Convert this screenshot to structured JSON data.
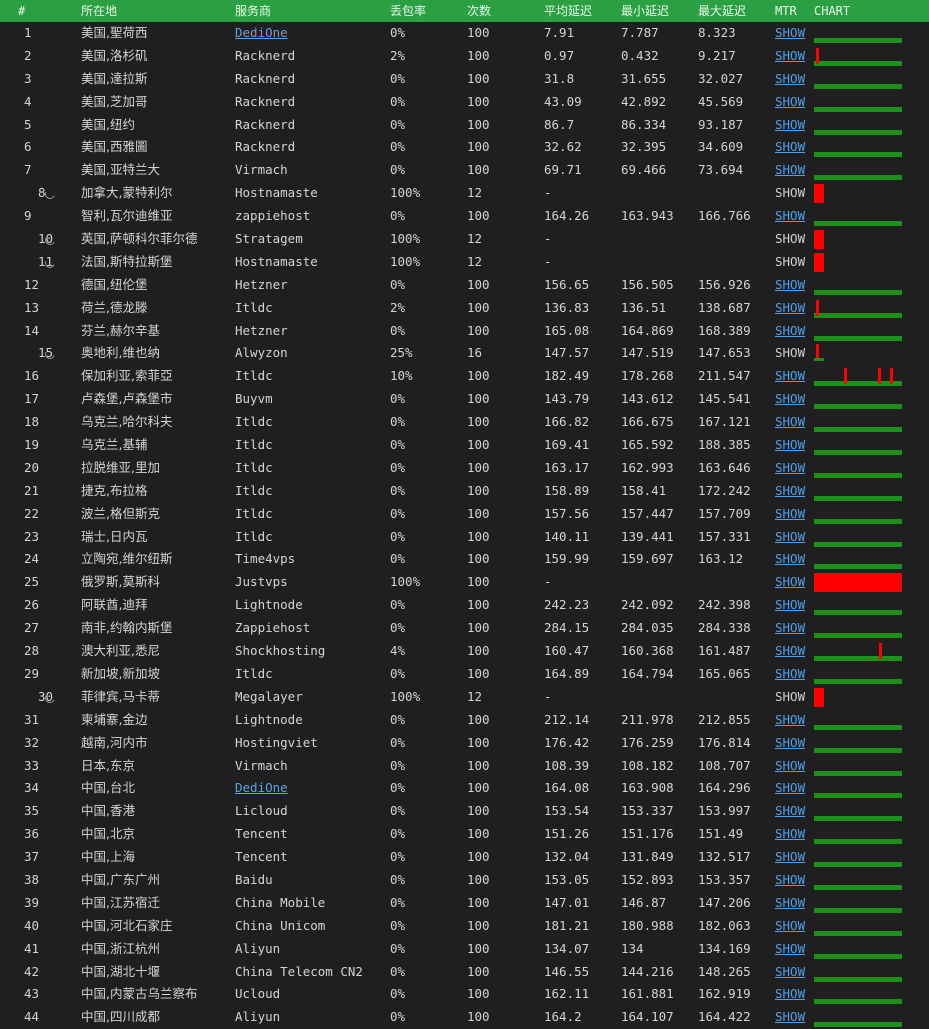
{
  "header": {
    "num": "#",
    "loc": "所在地",
    "prov": "服务商",
    "loss": "丢包率",
    "cnt": "次数",
    "avg": "平均延迟",
    "min": "最小延迟",
    "max": "最大延迟",
    "mtr": "MTR",
    "chart": "CHART"
  },
  "colors": {
    "header_bg": "#2aa042",
    "bar_green": "#1c8f1c",
    "bar_red": "#ff0000",
    "link": "#4d9fec"
  },
  "rows": [
    {
      "num": "1",
      "loc": "美国,聖荷西",
      "prov": "DediOne",
      "provLink": true,
      "loss": "0%",
      "cnt": "100",
      "avg": "7.91",
      "min": "7.787",
      "max": "8.323",
      "mtr": "SHOW",
      "mtrLink": true,
      "pending": false,
      "spark": "green",
      "spikes": []
    },
    {
      "num": "2",
      "loc": "美国,洛杉矶",
      "prov": "Racknerd",
      "provLink": false,
      "loss": "2%",
      "cnt": "100",
      "avg": "0.97",
      "min": "0.432",
      "max": "9.217",
      "mtr": "SHOW",
      "mtrLink": true,
      "pending": false,
      "spark": "green",
      "spikes": [
        0.02
      ]
    },
    {
      "num": "3",
      "loc": "美国,達拉斯",
      "prov": "Racknerd",
      "provLink": false,
      "loss": "0%",
      "cnt": "100",
      "avg": "31.8",
      "min": "31.655",
      "max": "32.027",
      "mtr": "SHOW",
      "mtrLink": true,
      "pending": false,
      "spark": "green",
      "spikes": []
    },
    {
      "num": "4",
      "loc": "美国,芝加哥",
      "prov": "Racknerd",
      "provLink": false,
      "loss": "0%",
      "cnt": "100",
      "avg": "43.09",
      "min": "42.892",
      "max": "45.569",
      "mtr": "SHOW",
      "mtrLink": true,
      "pending": false,
      "spark": "green",
      "spikes": []
    },
    {
      "num": "5",
      "loc": "美国,纽约",
      "prov": "Racknerd",
      "provLink": false,
      "loss": "0%",
      "cnt": "100",
      "avg": "86.7",
      "min": "86.334",
      "max": "93.187",
      "mtr": "SHOW",
      "mtrLink": true,
      "pending": false,
      "spark": "green",
      "spikes": []
    },
    {
      "num": "6",
      "loc": "美国,西雅圖",
      "prov": "Racknerd",
      "provLink": false,
      "loss": "0%",
      "cnt": "100",
      "avg": "32.62",
      "min": "32.395",
      "max": "34.609",
      "mtr": "SHOW",
      "mtrLink": true,
      "pending": false,
      "spark": "green",
      "spikes": []
    },
    {
      "num": "7",
      "loc": "美国,亚特兰大",
      "prov": "Virmach",
      "provLink": false,
      "loss": "0%",
      "cnt": "100",
      "avg": "69.71",
      "min": "69.466",
      "max": "73.694",
      "mtr": "SHOW",
      "mtrLink": true,
      "pending": false,
      "spark": "green",
      "spikes": []
    },
    {
      "num": "8",
      "loc": "加拿大,蒙特利尔",
      "prov": "Hostnamaste",
      "provLink": false,
      "loss": "100%",
      "cnt": "12",
      "avg": "-",
      "min": "",
      "max": "",
      "mtr": "SHOW",
      "mtrLink": false,
      "pending": true,
      "spark": "redshort",
      "spikes": []
    },
    {
      "num": "9",
      "loc": "智利,瓦尔迪维亚",
      "prov": "zappiehost",
      "provLink": false,
      "loss": "0%",
      "cnt": "100",
      "avg": "164.26",
      "min": "163.943",
      "max": "166.766",
      "mtr": "SHOW",
      "mtrLink": true,
      "pending": false,
      "spark": "green",
      "spikes": []
    },
    {
      "num": "10",
      "loc": "英国,萨顿科尔菲尔德",
      "prov": "Stratagem",
      "provLink": false,
      "loss": "100%",
      "cnt": "12",
      "avg": "-",
      "min": "",
      "max": "",
      "mtr": "SHOW",
      "mtrLink": false,
      "pending": true,
      "spark": "redshort",
      "spikes": []
    },
    {
      "num": "11",
      "loc": "法国,斯特拉斯堡",
      "prov": "Hostnamaste",
      "provLink": false,
      "loss": "100%",
      "cnt": "12",
      "avg": "-",
      "min": "",
      "max": "",
      "mtr": "SHOW",
      "mtrLink": false,
      "pending": true,
      "spark": "redshort",
      "spikes": []
    },
    {
      "num": "12",
      "loc": "德国,纽伦堡",
      "prov": "Hetzner",
      "provLink": false,
      "loss": "0%",
      "cnt": "100",
      "avg": "156.65",
      "min": "156.505",
      "max": "156.926",
      "mtr": "SHOW",
      "mtrLink": true,
      "pending": false,
      "spark": "green",
      "spikes": []
    },
    {
      "num": "13",
      "loc": "荷兰,德龙滕",
      "prov": "Itldc",
      "provLink": false,
      "loss": "2%",
      "cnt": "100",
      "avg": "136.83",
      "min": "136.51",
      "max": "138.687",
      "mtr": "SHOW",
      "mtrLink": true,
      "pending": false,
      "spark": "green",
      "spikes": [
        0.02
      ]
    },
    {
      "num": "14",
      "loc": "芬兰,赫尔辛基",
      "prov": "Hetzner",
      "provLink": false,
      "loss": "0%",
      "cnt": "100",
      "avg": "165.08",
      "min": "164.869",
      "max": "168.389",
      "mtr": "SHOW",
      "mtrLink": true,
      "pending": false,
      "spark": "green",
      "spikes": []
    },
    {
      "num": "15",
      "loc": "奥地利,维也纳",
      "prov": "Alwyzon",
      "provLink": false,
      "loss": "25%",
      "cnt": "16",
      "avg": "147.57",
      "min": "147.519",
      "max": "147.653",
      "mtr": "SHOW",
      "mtrLink": false,
      "pending": true,
      "spark": "tiny",
      "spikes": []
    },
    {
      "num": "16",
      "loc": "保加利亚,索菲亞",
      "prov": "Itldc",
      "provLink": false,
      "loss": "10%",
      "cnt": "100",
      "avg": "182.49",
      "min": "178.268",
      "max": "211.547",
      "mtr": "SHOW",
      "mtrLink": true,
      "pending": false,
      "spark": "green",
      "spikes": [
        0.34,
        0.73,
        0.86
      ]
    },
    {
      "num": "17",
      "loc": "卢森堡,卢森堡市",
      "prov": "Buyvm",
      "provLink": false,
      "loss": "0%",
      "cnt": "100",
      "avg": "143.79",
      "min": "143.612",
      "max": "145.541",
      "mtr": "SHOW",
      "mtrLink": true,
      "pending": false,
      "spark": "green",
      "spikes": []
    },
    {
      "num": "18",
      "loc": "乌克兰,哈尔科夫",
      "prov": "Itldc",
      "provLink": false,
      "loss": "0%",
      "cnt": "100",
      "avg": "166.82",
      "min": "166.675",
      "max": "167.121",
      "mtr": "SHOW",
      "mtrLink": true,
      "pending": false,
      "spark": "green",
      "spikes": []
    },
    {
      "num": "19",
      "loc": "乌克兰,基辅",
      "prov": "Itldc",
      "provLink": false,
      "loss": "0%",
      "cnt": "100",
      "avg": "169.41",
      "min": "165.592",
      "max": "188.385",
      "mtr": "SHOW",
      "mtrLink": true,
      "pending": false,
      "spark": "green",
      "spikes": []
    },
    {
      "num": "20",
      "loc": "拉脱维亚,里加",
      "prov": "Itldc",
      "provLink": false,
      "loss": "0%",
      "cnt": "100",
      "avg": "163.17",
      "min": "162.993",
      "max": "163.646",
      "mtr": "SHOW",
      "mtrLink": true,
      "pending": false,
      "spark": "green",
      "spikes": []
    },
    {
      "num": "21",
      "loc": "捷克,布拉格",
      "prov": "Itldc",
      "provLink": false,
      "loss": "0%",
      "cnt": "100",
      "avg": "158.89",
      "min": "158.41",
      "max": "172.242",
      "mtr": "SHOW",
      "mtrLink": true,
      "pending": false,
      "spark": "green",
      "spikes": []
    },
    {
      "num": "22",
      "loc": "波兰,格但斯克",
      "prov": "Itldc",
      "provLink": false,
      "loss": "0%",
      "cnt": "100",
      "avg": "157.56",
      "min": "157.447",
      "max": "157.709",
      "mtr": "SHOW",
      "mtrLink": true,
      "pending": false,
      "spark": "green",
      "spikes": []
    },
    {
      "num": "23",
      "loc": "瑞士,日内瓦",
      "prov": "Itldc",
      "provLink": false,
      "loss": "0%",
      "cnt": "100",
      "avg": "140.11",
      "min": "139.441",
      "max": "157.331",
      "mtr": "SHOW",
      "mtrLink": true,
      "pending": false,
      "spark": "green",
      "spikes": []
    },
    {
      "num": "24",
      "loc": "立陶宛,维尔纽斯",
      "prov": "Time4vps",
      "provLink": false,
      "loss": "0%",
      "cnt": "100",
      "avg": "159.99",
      "min": "159.697",
      "max": "163.12",
      "mtr": "SHOW",
      "mtrLink": true,
      "pending": false,
      "spark": "green",
      "spikes": []
    },
    {
      "num": "25",
      "loc": "俄罗斯,莫斯科",
      "prov": "Justvps",
      "provLink": false,
      "loss": "100%",
      "cnt": "100",
      "avg": "-",
      "min": "",
      "max": "",
      "mtr": "SHOW",
      "mtrLink": true,
      "pending": false,
      "spark": "redfull",
      "spikes": []
    },
    {
      "num": "26",
      "loc": "阿联酋,迪拜",
      "prov": "Lightnode",
      "provLink": false,
      "loss": "0%",
      "cnt": "100",
      "avg": "242.23",
      "min": "242.092",
      "max": "242.398",
      "mtr": "SHOW",
      "mtrLink": true,
      "pending": false,
      "spark": "green",
      "spikes": []
    },
    {
      "num": "27",
      "loc": "南非,约翰内斯堡",
      "prov": "Zappiehost",
      "provLink": false,
      "loss": "0%",
      "cnt": "100",
      "avg": "284.15",
      "min": "284.035",
      "max": "284.338",
      "mtr": "SHOW",
      "mtrLink": true,
      "pending": false,
      "spark": "green",
      "spikes": []
    },
    {
      "num": "28",
      "loc": "澳大利亚,悉尼",
      "prov": "Shockhosting",
      "provLink": false,
      "loss": "4%",
      "cnt": "100",
      "avg": "160.47",
      "min": "160.368",
      "max": "161.487",
      "mtr": "SHOW",
      "mtrLink": true,
      "pending": false,
      "spark": "green",
      "spikes": [
        0.74
      ]
    },
    {
      "num": "29",
      "loc": "新加坡,新加坡",
      "prov": "Itldc",
      "provLink": false,
      "loss": "0%",
      "cnt": "100",
      "avg": "164.89",
      "min": "164.794",
      "max": "165.065",
      "mtr": "SHOW",
      "mtrLink": true,
      "pending": false,
      "spark": "green",
      "spikes": []
    },
    {
      "num": "30",
      "loc": "菲律宾,马卡蒂",
      "prov": "Megalayer",
      "provLink": false,
      "loss": "100%",
      "cnt": "12",
      "avg": "-",
      "min": "",
      "max": "",
      "mtr": "SHOW",
      "mtrLink": false,
      "pending": true,
      "spark": "redshort",
      "spikes": []
    },
    {
      "num": "31",
      "loc": "柬埔寨,金边",
      "prov": "Lightnode",
      "provLink": false,
      "loss": "0%",
      "cnt": "100",
      "avg": "212.14",
      "min": "211.978",
      "max": "212.855",
      "mtr": "SHOW",
      "mtrLink": true,
      "pending": false,
      "spark": "green",
      "spikes": []
    },
    {
      "num": "32",
      "loc": "越南,河内市",
      "prov": "Hostingviet",
      "provLink": false,
      "loss": "0%",
      "cnt": "100",
      "avg": "176.42",
      "min": "176.259",
      "max": "176.814",
      "mtr": "SHOW",
      "mtrLink": true,
      "pending": false,
      "spark": "green",
      "spikes": []
    },
    {
      "num": "33",
      "loc": "日本,东京",
      "prov": "Virmach",
      "provLink": false,
      "loss": "0%",
      "cnt": "100",
      "avg": "108.39",
      "min": "108.182",
      "max": "108.707",
      "mtr": "SHOW",
      "mtrLink": true,
      "pending": false,
      "spark": "green",
      "spikes": []
    },
    {
      "num": "34",
      "loc": "中国,台北",
      "prov": "DediOne",
      "provLink": true,
      "loss": "0%",
      "cnt": "100",
      "avg": "164.08",
      "min": "163.908",
      "max": "164.296",
      "mtr": "SHOW",
      "mtrLink": true,
      "pending": false,
      "spark": "green",
      "spikes": []
    },
    {
      "num": "35",
      "loc": "中国,香港",
      "prov": "Licloud",
      "provLink": false,
      "loss": "0%",
      "cnt": "100",
      "avg": "153.54",
      "min": "153.337",
      "max": "153.997",
      "mtr": "SHOW",
      "mtrLink": true,
      "pending": false,
      "spark": "green",
      "spikes": []
    },
    {
      "num": "36",
      "loc": "中国,北京",
      "prov": "Tencent",
      "provLink": false,
      "loss": "0%",
      "cnt": "100",
      "avg": "151.26",
      "min": "151.176",
      "max": "151.49",
      "mtr": "SHOW",
      "mtrLink": true,
      "pending": false,
      "spark": "green",
      "spikes": []
    },
    {
      "num": "37",
      "loc": "中国,上海",
      "prov": "Tencent",
      "provLink": false,
      "loss": "0%",
      "cnt": "100",
      "avg": "132.04",
      "min": "131.849",
      "max": "132.517",
      "mtr": "SHOW",
      "mtrLink": true,
      "pending": false,
      "spark": "green",
      "spikes": []
    },
    {
      "num": "38",
      "loc": "中国,广东广州",
      "prov": "Baidu",
      "provLink": false,
      "loss": "0%",
      "cnt": "100",
      "avg": "153.05",
      "min": "152.893",
      "max": "153.357",
      "mtr": "SHOW",
      "mtrLink": true,
      "pending": false,
      "spark": "green",
      "spikes": []
    },
    {
      "num": "39",
      "loc": "中国,江苏宿迁",
      "prov": "China Mobile",
      "provLink": false,
      "loss": "0%",
      "cnt": "100",
      "avg": "147.01",
      "min": "146.87",
      "max": "147.206",
      "mtr": "SHOW",
      "mtrLink": true,
      "pending": false,
      "spark": "green",
      "spikes": []
    },
    {
      "num": "40",
      "loc": "中国,河北石家庄",
      "prov": "China Unicom",
      "provLink": false,
      "loss": "0%",
      "cnt": "100",
      "avg": "181.21",
      "min": "180.988",
      "max": "182.063",
      "mtr": "SHOW",
      "mtrLink": true,
      "pending": false,
      "spark": "green",
      "spikes": []
    },
    {
      "num": "41",
      "loc": "中国,浙江杭州",
      "prov": "Aliyun",
      "provLink": false,
      "loss": "0%",
      "cnt": "100",
      "avg": "134.07",
      "min": "134",
      "max": "134.169",
      "mtr": "SHOW",
      "mtrLink": true,
      "pending": false,
      "spark": "green",
      "spikes": []
    },
    {
      "num": "42",
      "loc": "中国,湖北十堰",
      "prov": "China Telecom CN2",
      "provLink": false,
      "loss": "0%",
      "cnt": "100",
      "avg": "146.55",
      "min": "144.216",
      "max": "148.265",
      "mtr": "SHOW",
      "mtrLink": true,
      "pending": false,
      "spark": "green",
      "spikes": []
    },
    {
      "num": "43",
      "loc": "中国,内蒙古乌兰察布",
      "prov": "Ucloud",
      "provLink": false,
      "loss": "0%",
      "cnt": "100",
      "avg": "162.11",
      "min": "161.881",
      "max": "162.919",
      "mtr": "SHOW",
      "mtrLink": true,
      "pending": false,
      "spark": "green",
      "spikes": []
    },
    {
      "num": "44",
      "loc": "中国,四川成都",
      "prov": "Aliyun",
      "provLink": false,
      "loss": "0%",
      "cnt": "100",
      "avg": "164.2",
      "min": "164.107",
      "max": "164.422",
      "mtr": "SHOW",
      "mtrLink": true,
      "pending": false,
      "spark": "green",
      "spikes": []
    }
  ]
}
